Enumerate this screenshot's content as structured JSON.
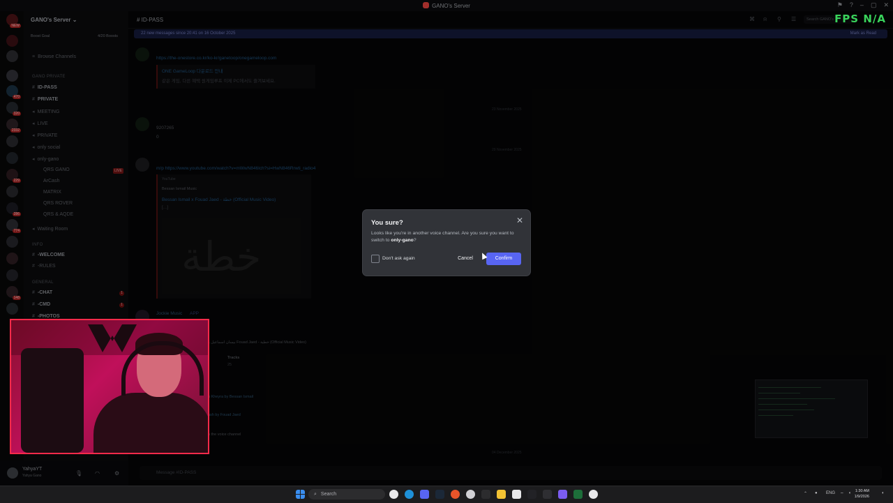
{
  "window": {
    "title": "GANO's Server",
    "fps_label": "FPS",
    "fps_value": "N/A"
  },
  "server": {
    "name": "GANO's Server",
    "boost_goal": "Boost Goal",
    "boost_count": "4/20 Boosts",
    "browse_channels": "Browse Channels"
  },
  "sidebar": {
    "category_gano": "GANO PRIVATE",
    "channels": [
      {
        "name": "ID-PASS",
        "selected": true
      },
      {
        "name": "PRIVATE",
        "selected": false
      },
      {
        "name": "MEETING",
        "selected": false
      },
      {
        "name": "LIVE",
        "selected": false
      },
      {
        "name": "PRIVATE",
        "selected": false
      },
      {
        "name": "only social",
        "selected": false
      },
      {
        "name": "only-gano",
        "selected": false
      }
    ],
    "voice_members": [
      "QRS GANO",
      "ArCash",
      "MATRIX",
      "QRS ROVER",
      "QRS & AQDE"
    ],
    "live_badge": "LIVE",
    "waiting_room": "Waiting Room",
    "category_info": "INFO",
    "info_channels": [
      "-WELCOME",
      "-RULES"
    ],
    "category_general": "GENERAL",
    "general_channels": [
      "-CHAT",
      "-CMD",
      "-PHOTOS"
    ],
    "server_badges": [
      "NEW",
      "470",
      "320",
      "2332",
      "229",
      "286",
      "774",
      "148"
    ]
  },
  "user": {
    "name": "YahyaYT",
    "status": "Yahya Gano"
  },
  "chat": {
    "channel_name": "ID-PASS",
    "search_placeholder": "Search GANO's",
    "banner_text": "22 new messages since 20:41 on 16 October 2025",
    "banner_action": "Mark as Read",
    "date_1": "23 November 2025",
    "date_2": "29 November 2025",
    "date_3": "04 December 2025",
    "msg1_link": "https://the-onestore.co.kr/ko-kr/ganetoop/onegameloop.com",
    "msg1_title": "ONE GameLoop 다운로드 안내",
    "msg1_desc": "같은 게임, 다른 혜택 원게임루프 이제 PC에서도 즐겨보세요.",
    "msg2_line1": "9207265",
    "msg2_line2": "0",
    "msg3_link": "m/p https://www.youtube.com/watch?v=mWwN846Ich?si=HwN846Rrwti_radio4",
    "embed_provider": "YouTube",
    "embed_channel": "Bessan Ismail Music",
    "embed_title": "Bessan Ismail x Fouad Jaed - خطة (Official Music Video)",
    "embed_more": "[...]",
    "bot_name": "Jockie Music",
    "bot_tag": "APP",
    "bot_track": "بيسان اسماعيل و Fouad Jaed - خطية (Official Music Video)",
    "tracks_label": "Tracks",
    "tracks_count": "25",
    "bot_line1": "u Kheyra by Bessan Ismail",
    "bot_line2": "ash by Fouad Jaed",
    "bot_line3": "n the voice channel",
    "composer_placeholder": "Message #ID-PASS"
  },
  "modal": {
    "title": "You sure?",
    "body_prefix": "Looks like you're in another voice channel. Are you sure you want to switch to ",
    "body_channel": "only-gano",
    "body_suffix": "?",
    "checkbox_label": "Don't ask again",
    "checkbox_checked": false,
    "cancel_label": "Cancel",
    "confirm_label": "Confirm",
    "accent_color": "#5865f2"
  },
  "taskbar": {
    "search_label": "Search",
    "lang": "ENG",
    "time": "1:30 AM",
    "date": "1/9/2026"
  }
}
